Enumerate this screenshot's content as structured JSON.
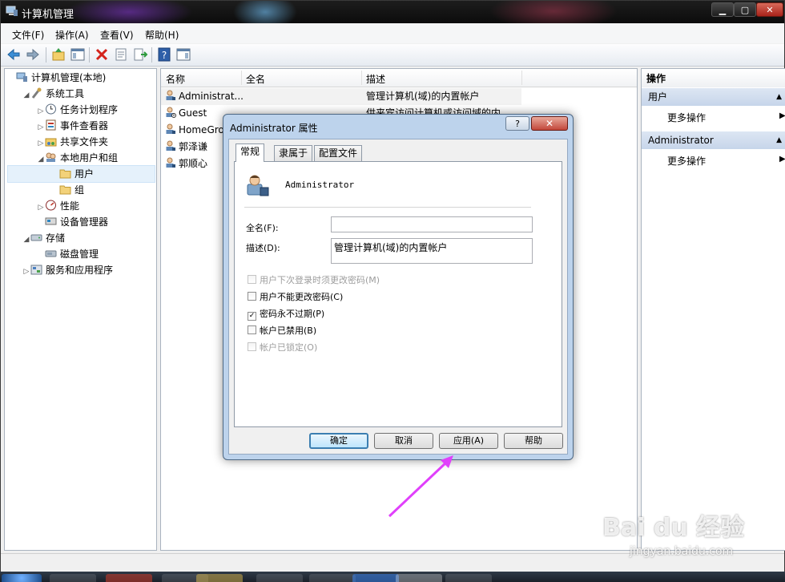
{
  "window": {
    "title": "计算机管理"
  },
  "menu": [
    "文件(F)",
    "操作(A)",
    "查看(V)",
    "帮助(H)"
  ],
  "tree": {
    "items": [
      {
        "label": "计算机管理(本地)",
        "indent": 0,
        "arrow": "",
        "icon": "computer-management-icon"
      },
      {
        "label": "系统工具",
        "indent": 1,
        "arrow": "◢",
        "icon": "system-tools-icon"
      },
      {
        "label": "任务计划程序",
        "indent": 2,
        "arrow": "▷",
        "icon": "task-scheduler-icon"
      },
      {
        "label": "事件查看器",
        "indent": 2,
        "arrow": "▷",
        "icon": "event-viewer-icon"
      },
      {
        "label": "共享文件夹",
        "indent": 2,
        "arrow": "▷",
        "icon": "shared-folders-icon"
      },
      {
        "label": "本地用户和组",
        "indent": 2,
        "arrow": "◢",
        "icon": "local-users-groups-icon"
      },
      {
        "label": "用户",
        "indent": 3,
        "arrow": "",
        "icon": "folder-icon"
      },
      {
        "label": "组",
        "indent": 3,
        "arrow": "",
        "icon": "folder-icon"
      },
      {
        "label": "性能",
        "indent": 2,
        "arrow": "▷",
        "icon": "performance-icon"
      },
      {
        "label": "设备管理器",
        "indent": 2,
        "arrow": "",
        "icon": "device-manager-icon"
      },
      {
        "label": "存储",
        "indent": 1,
        "arrow": "◢",
        "icon": "storage-icon"
      },
      {
        "label": "磁盘管理",
        "indent": 2,
        "arrow": "",
        "icon": "disk-management-icon"
      },
      {
        "label": "服务和应用程序",
        "indent": 1,
        "arrow": "▷",
        "icon": "services-apps-icon"
      }
    ]
  },
  "list": {
    "columns": [
      "名称",
      "全名",
      "描述"
    ],
    "rows": [
      {
        "name": "Administrat...",
        "desc": "管理计算机(域)的内置帐户"
      },
      {
        "name": "Guest",
        "desc": "供来宾访问计算机或访问域的内..."
      },
      {
        "name": "HomeGro...",
        "desc": ""
      },
      {
        "name": "郭泽谦",
        "desc": ""
      },
      {
        "name": "郭顺心",
        "desc": ""
      }
    ]
  },
  "actions": {
    "title": "操作",
    "sections": [
      {
        "label": "用户",
        "item": "更多操作"
      },
      {
        "label": "Administrator",
        "item": "更多操作"
      }
    ]
  },
  "dialog": {
    "title": "Administrator 属性",
    "help_glyph": "?",
    "close_glyph": "✕",
    "tabs": [
      "常规",
      "隶属于",
      "配置文件"
    ],
    "username": "Administrator",
    "fullname_label": "全名(F):",
    "fullname_value": "",
    "desc_label": "描述(D):",
    "desc_value": "管理计算机(域)的内置帐户",
    "checkboxes": [
      {
        "label": "用户下次登录时须更改密码(M)",
        "checked": false,
        "disabled": true
      },
      {
        "label": "用户不能更改密码(C)",
        "checked": false,
        "disabled": false
      },
      {
        "label": "密码永不过期(P)",
        "checked": true,
        "disabled": false
      },
      {
        "label": "帐户已禁用(B)",
        "checked": false,
        "disabled": false
      },
      {
        "label": "帐户已锁定(O)",
        "checked": false,
        "disabled": true
      }
    ],
    "buttons": {
      "ok": "确定",
      "cancel": "取消",
      "apply": "应用(A)",
      "help": "帮助"
    }
  },
  "watermark": {
    "brand": "Bai du 经验",
    "url": "jingyan.baidu.com"
  },
  "colors": {
    "arrow": "#e040fb",
    "selection": "#cce8ff",
    "dialog_frame": "#bdd3ec"
  }
}
